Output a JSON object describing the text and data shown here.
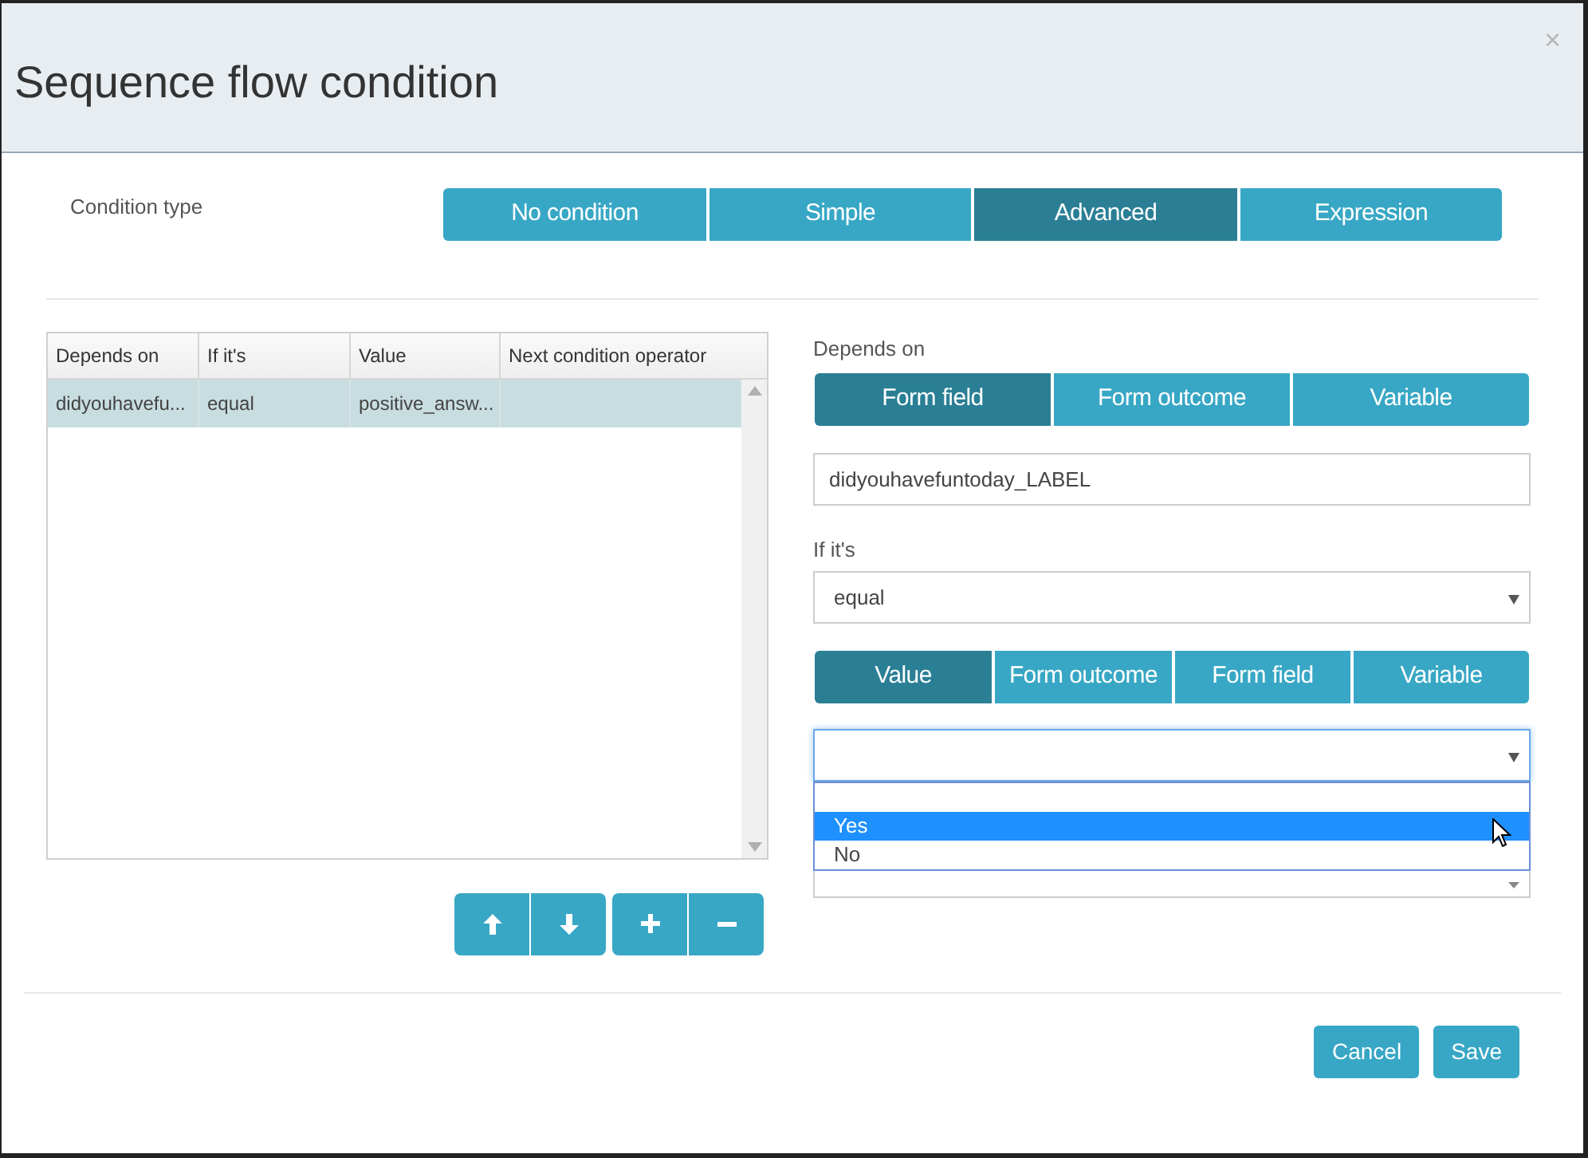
{
  "dialog": {
    "title": "Sequence flow condition",
    "close": "×"
  },
  "condition_type": {
    "label": "Condition type",
    "options": [
      {
        "label": "No condition",
        "selected": false
      },
      {
        "label": "Simple",
        "selected": false
      },
      {
        "label": "Advanced",
        "selected": true
      },
      {
        "label": "Expression",
        "selected": false
      }
    ]
  },
  "table": {
    "columns": [
      "Depends on",
      "If it's",
      "Value",
      "Next condition operator"
    ],
    "rows": [
      {
        "cells": [
          "didyouhavefu...",
          "equal",
          "positive_answ...",
          ""
        ],
        "selected": true
      }
    ]
  },
  "row_buttons": [
    {
      "kind": "up"
    },
    {
      "kind": "down"
    },
    {
      "kind": "add"
    },
    {
      "kind": "remove"
    }
  ],
  "depends_on": {
    "label": "Depends on",
    "options": [
      {
        "label": "Form field",
        "selected": true
      },
      {
        "label": "Form outcome",
        "selected": false
      },
      {
        "label": "Variable",
        "selected": false
      }
    ],
    "value": "didyouhavefuntoday_LABEL"
  },
  "if_its": {
    "label": "If it's",
    "value": "equal"
  },
  "value_source": {
    "options": [
      {
        "label": "Value",
        "selected": true
      },
      {
        "label": "Form outcome",
        "selected": false
      },
      {
        "label": "Form field",
        "selected": false
      },
      {
        "label": "Variable",
        "selected": false
      }
    ]
  },
  "value_select": {
    "expanded": true,
    "options": [
      {
        "selected": false
      },
      {
        "label": "Yes",
        "selected": true
      },
      {
        "label": "No",
        "selected": false
      }
    ]
  },
  "footer_buttons": [
    "Cancel",
    "Save"
  ]
}
